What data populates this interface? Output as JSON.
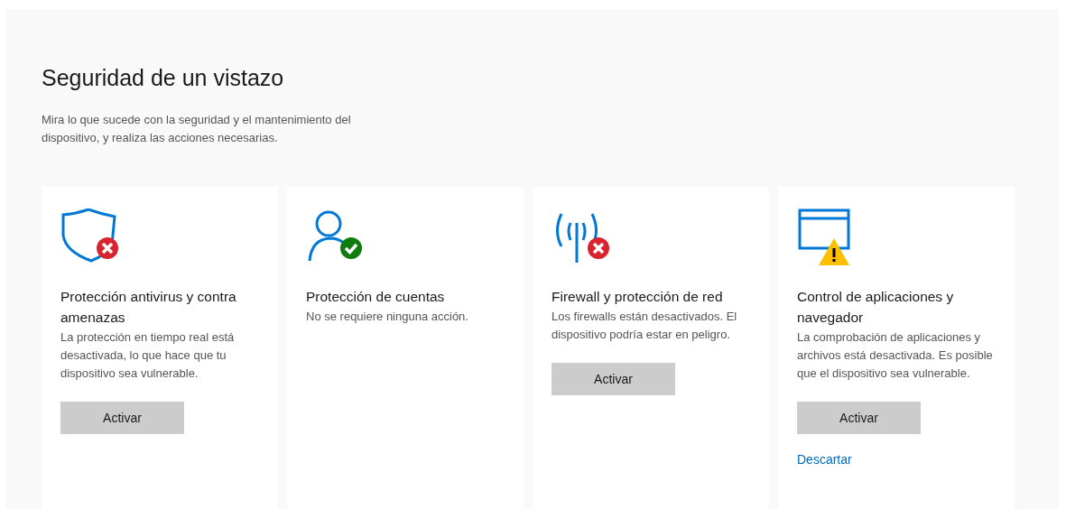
{
  "heading": "Seguridad de un vistazo",
  "intro": "Mira lo que sucede con la seguridad y el mantenimiento del dispositivo, y realiza las acciones necesarias.",
  "cards": [
    {
      "kind": "error",
      "title": "Protección antivirus y contra amenazas",
      "description": "La protección en tiempo real está desactivada, lo que hace que tu dispositivo sea vulnerable.",
      "button": "Activar"
    },
    {
      "kind": "ok",
      "title": "Protección de cuentas",
      "description": "No se requiere ninguna acción."
    },
    {
      "kind": "error",
      "title": "Firewall y protección de red",
      "description": "Los firewalls están desactivados. El dispositivo podría estar en peligro.",
      "button": "Activar"
    },
    {
      "kind": "warning",
      "title": "Control de aplicaciones y navegador",
      "description": "La comprobación de aplicaciones y archivos está desactivada. Es posible que el dispositivo sea vulnerable.",
      "button": "Activar",
      "link": "Descartar"
    }
  ]
}
